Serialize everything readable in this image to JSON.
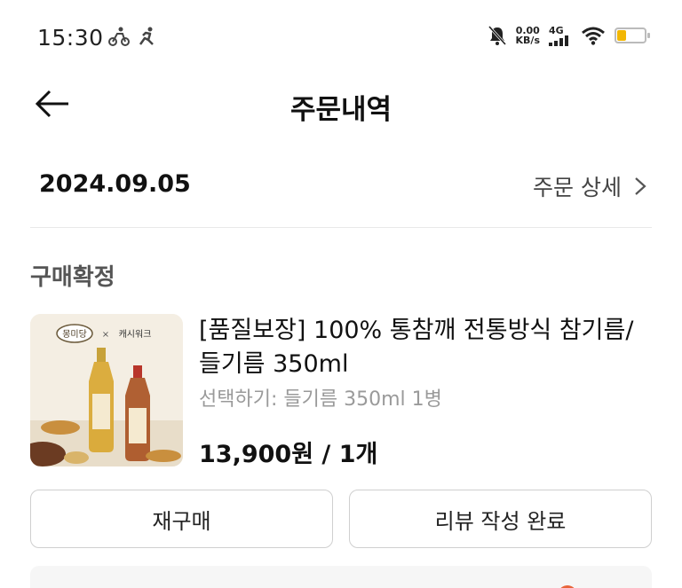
{
  "status_bar": {
    "time": "15:30",
    "net_speed_value": "0.00",
    "net_speed_unit": "KB/s",
    "network_type": "4G",
    "battery_level": 0.3
  },
  "header": {
    "title": "주문내역"
  },
  "order": {
    "date": "2024.09.05",
    "detail_link": "주문 상세",
    "status": "구매확정"
  },
  "product": {
    "name": "[품질보장] 100% 통참깨 전통방식 참기름/들기름 350ml",
    "option": "선택하기: 들기름 350ml 1병",
    "price": "13,900원 / 1개",
    "thumb_brand_left": "몽미당",
    "thumb_brand_x": "×",
    "thumb_brand_right": "캐시워크"
  },
  "buttons": {
    "rebuy": "재구매",
    "review": "리뷰 작성 완료"
  },
  "colors": {
    "accent": "#e8643a",
    "battery": "#f2b705"
  }
}
